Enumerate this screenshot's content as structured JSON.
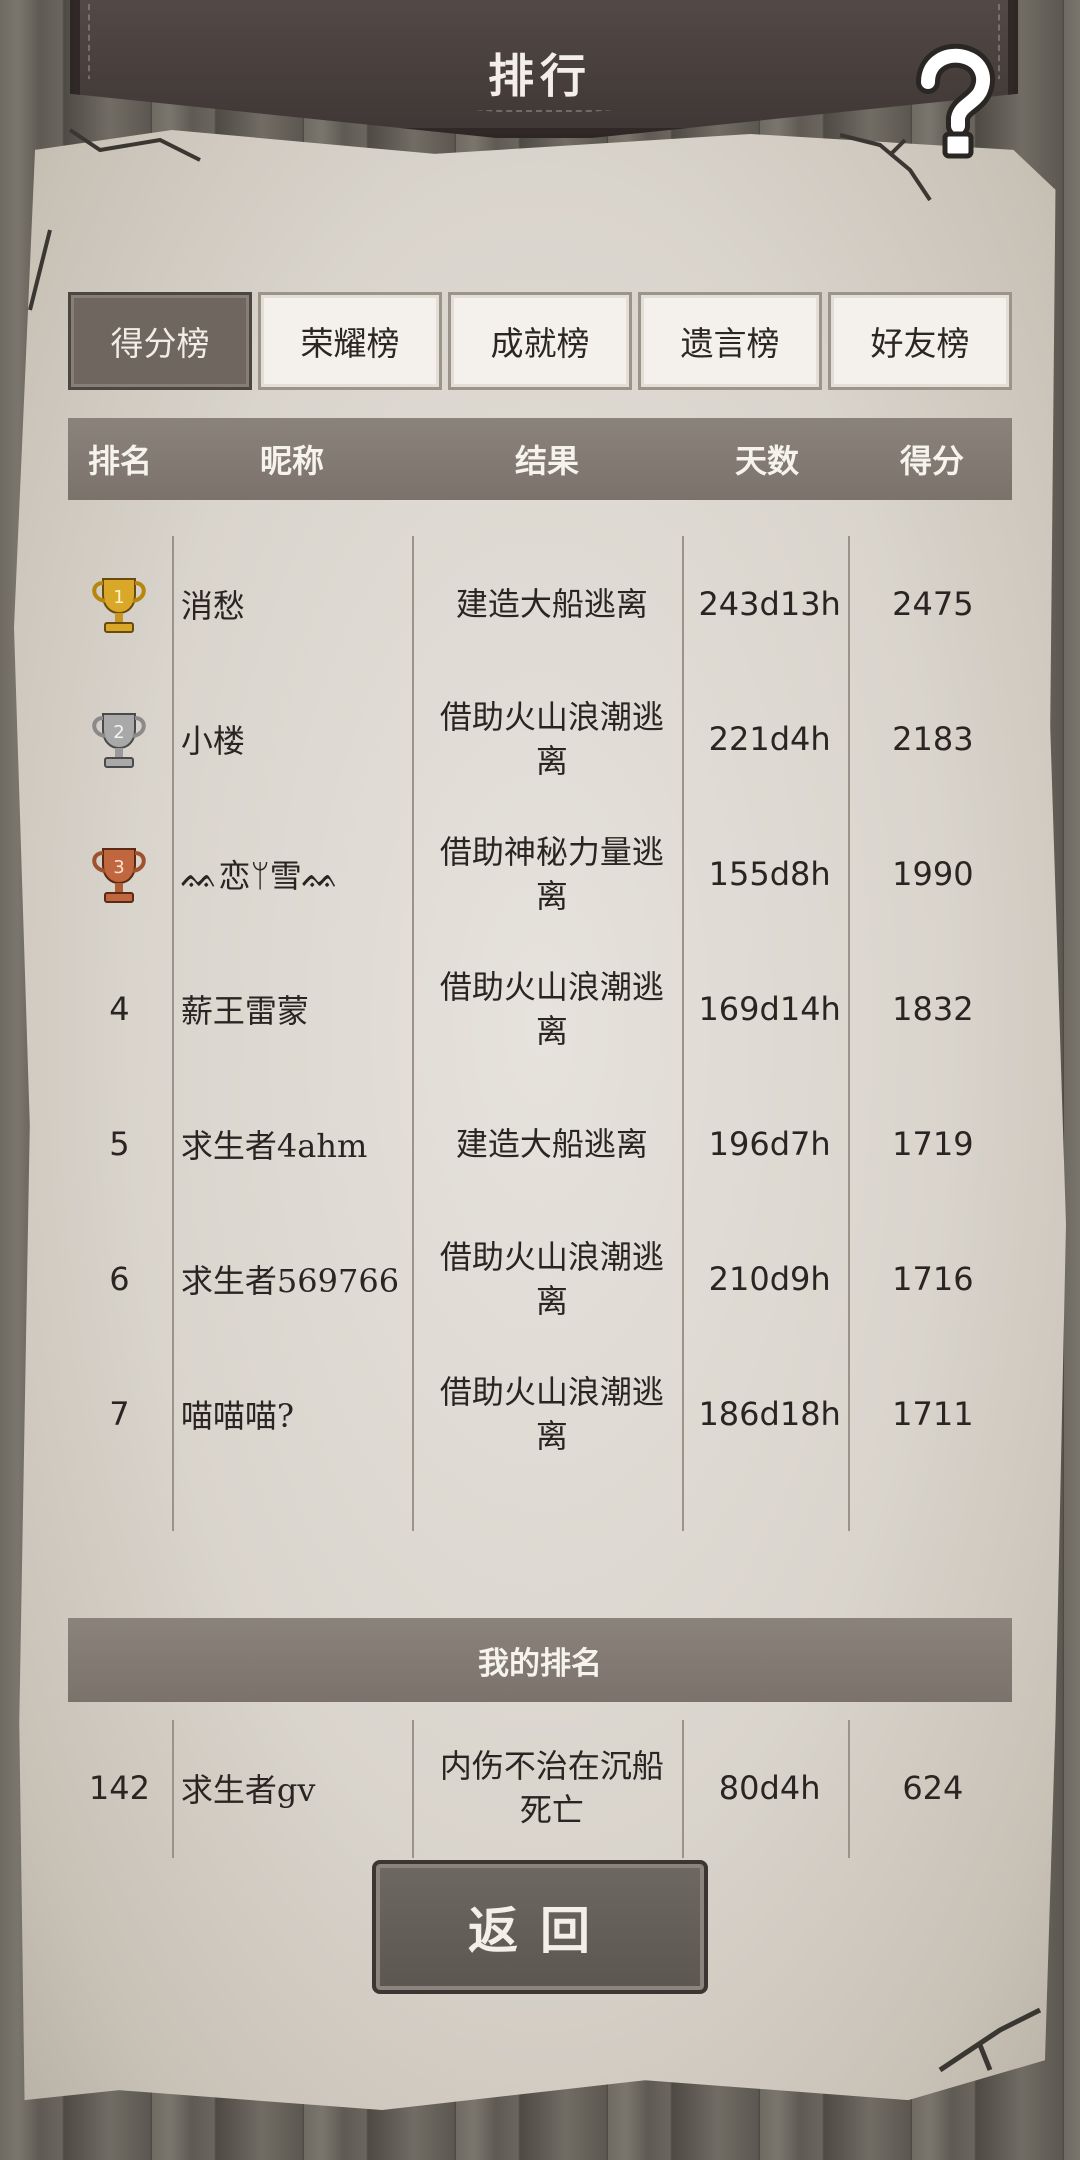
{
  "header": {
    "title": "排行"
  },
  "help_icon": "question-mark-icon",
  "tabs": [
    {
      "label": "得分榜",
      "active": true
    },
    {
      "label": "荣耀榜",
      "active": false
    },
    {
      "label": "成就榜",
      "active": false
    },
    {
      "label": "遗言榜",
      "active": false
    },
    {
      "label": "好友榜",
      "active": false
    }
  ],
  "table": {
    "headers": {
      "rank": "排名",
      "name": "昵称",
      "result": "结果",
      "days": "天数",
      "score": "得分"
    },
    "rows": [
      {
        "rank": "1",
        "medal": "gold-trophy-icon",
        "name": "消愁",
        "result": "建造大船逃离",
        "days": "243d13h",
        "score": "2475"
      },
      {
        "rank": "2",
        "medal": "silver-trophy-icon",
        "name": "小楼",
        "result": "借助火山浪潮逃离",
        "days": "221d4h",
        "score": "2183"
      },
      {
        "rank": "3",
        "medal": "bronze-trophy-icon",
        "name": "ᨐ恋ᛘ雪ᨐ",
        "result": "借助神秘力量逃离",
        "days": "155d8h",
        "score": "1990"
      },
      {
        "rank": "4",
        "medal": "",
        "name": "薪王雷蒙",
        "result": "借助火山浪潮逃离",
        "days": "169d14h",
        "score": "1832"
      },
      {
        "rank": "5",
        "medal": "",
        "name": "求生者4ahm",
        "result": "建造大船逃离",
        "days": "196d7h",
        "score": "1719"
      },
      {
        "rank": "6",
        "medal": "",
        "name": "求生者569766",
        "result": "借助火山浪潮逃离",
        "days": "210d9h",
        "score": "1716"
      },
      {
        "rank": "7",
        "medal": "",
        "name": "喵喵喵?",
        "result": "借助火山浪潮逃离",
        "days": "186d18h",
        "score": "1711"
      }
    ]
  },
  "my_rank": {
    "title": "我的排名",
    "rank": "142",
    "name": "求生者gv",
    "result": "内伤不治在沉船死亡",
    "days": "80d4h",
    "score": "624"
  },
  "back_button": {
    "label": "返回"
  },
  "colors": {
    "tab_active": "#6e665f",
    "header_bar": "#827a73",
    "paper": "#dcd7cf",
    "banner": "#4a413f"
  }
}
